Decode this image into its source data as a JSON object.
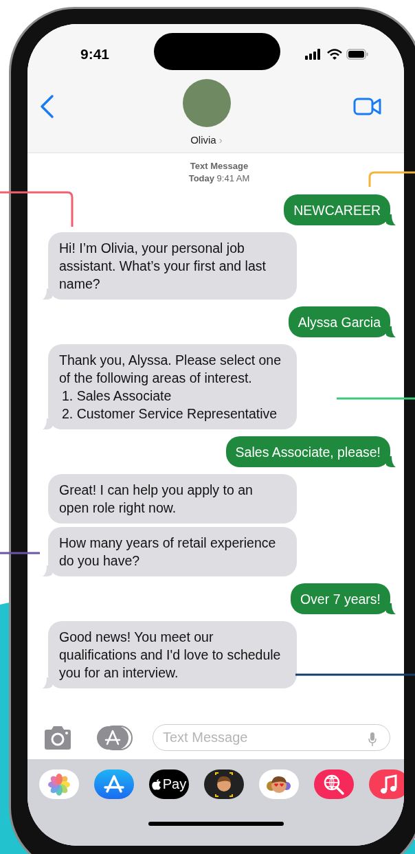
{
  "status_bar": {
    "time": "9:41"
  },
  "contact": {
    "name": "Olivia",
    "chevron": "›"
  },
  "thread": {
    "service": "Text Message",
    "timestamp": "**Today** 9:41 AM"
  },
  "messages": [
    {
      "kind": "sent",
      "text": "NEWCAREER",
      "tail": true
    },
    {
      "kind": "received",
      "text": "Hi! I’m Olivia, your personal job assistant. What’s your first and last name?",
      "tail": true
    },
    {
      "kind": "sent",
      "text": "Alyssa Garcia",
      "tail": true
    },
    {
      "kind": "received",
      "text": "Thank you, Alyssa. Please select one of the following areas of interest.",
      "list": [
        "1. Sales Associate",
        "2. Customer Service Representative"
      ],
      "tail": true
    },
    {
      "kind": "sent",
      "text": "Sales Associate, please!",
      "tail": true
    },
    {
      "kind": "received",
      "text": "Great! I can help you apply to an open role right now.",
      "tail": false
    },
    {
      "kind": "received",
      "text": "How many years of retail experience do you have?",
      "tail": true
    },
    {
      "kind": "sent",
      "text": "Over 7 years!",
      "tail": true
    },
    {
      "kind": "received",
      "text": "Good news! You meet our qualifications and I'd love to schedule you for an interview.",
      "tail": true
    }
  ],
  "composer": {
    "placeholder": "Text Message"
  },
  "app_drawer": [
    {
      "kind": "photos"
    },
    {
      "kind": "appstore"
    },
    {
      "kind": "pay",
      "label": "Pay"
    },
    {
      "kind": "memoji"
    },
    {
      "kind": "stickers"
    },
    {
      "kind": "search"
    },
    {
      "kind": "music"
    }
  ]
}
